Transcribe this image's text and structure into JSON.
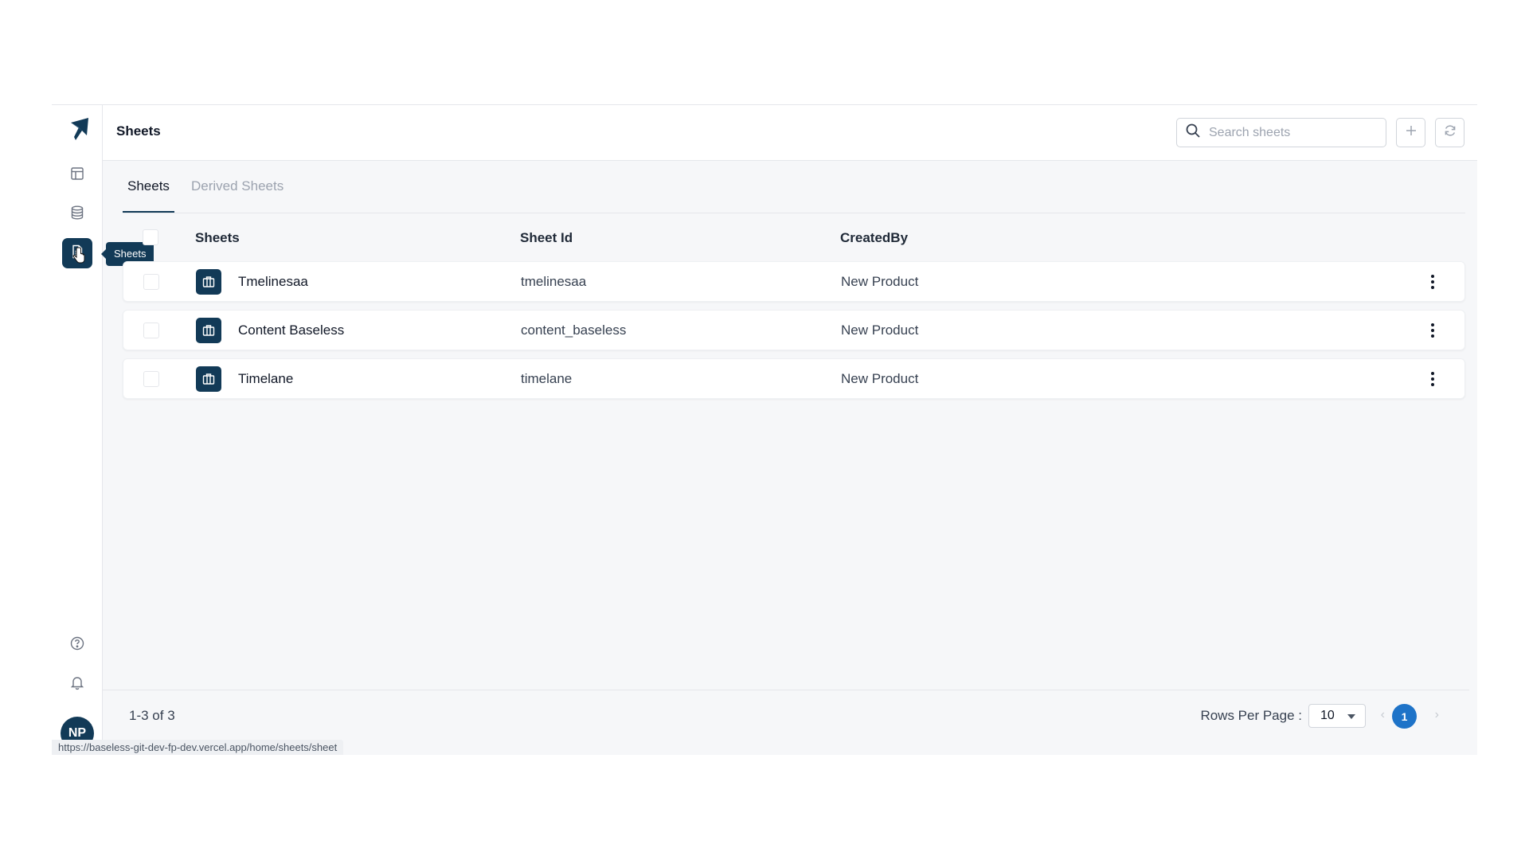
{
  "header": {
    "title": "Sheets",
    "search_placeholder": "Search sheets"
  },
  "sidebar": {
    "items": [
      {
        "name": "dashboard",
        "icon": "layout-icon"
      },
      {
        "name": "database",
        "icon": "database-icon"
      },
      {
        "name": "sheets",
        "icon": "document-icon",
        "active": true
      }
    ],
    "tooltip": "Sheets",
    "bottom": [
      {
        "icon": "help-icon"
      },
      {
        "icon": "bell-icon"
      }
    ],
    "avatar_initials": "NP"
  },
  "tabs": [
    {
      "label": "Sheets",
      "active": true
    },
    {
      "label": "Derived Sheets",
      "active": false
    }
  ],
  "table": {
    "columns": [
      "Sheets",
      "Sheet Id",
      "CreatedBy"
    ],
    "rows": [
      {
        "name": "Tmelinesaa",
        "sheet_id": "tmelinesaa",
        "created_by": "New Product"
      },
      {
        "name": "Content Baseless",
        "sheet_id": "content_baseless",
        "created_by": "New Product"
      },
      {
        "name": "Timelane",
        "sheet_id": "timelane",
        "created_by": "New Product"
      }
    ]
  },
  "footer": {
    "count": "1-3 of 3",
    "rows_per_page_label": "Rows Per Page :",
    "rows_per_page_value": "10",
    "current_page": "1",
    "prev": "‹",
    "next": "›"
  },
  "status_url": "https://baseless-git-dev-fp-dev.vercel.app/home/sheets/sheet",
  "colors": {
    "accent": "#123a57",
    "pagination_active": "#1e73c8"
  }
}
